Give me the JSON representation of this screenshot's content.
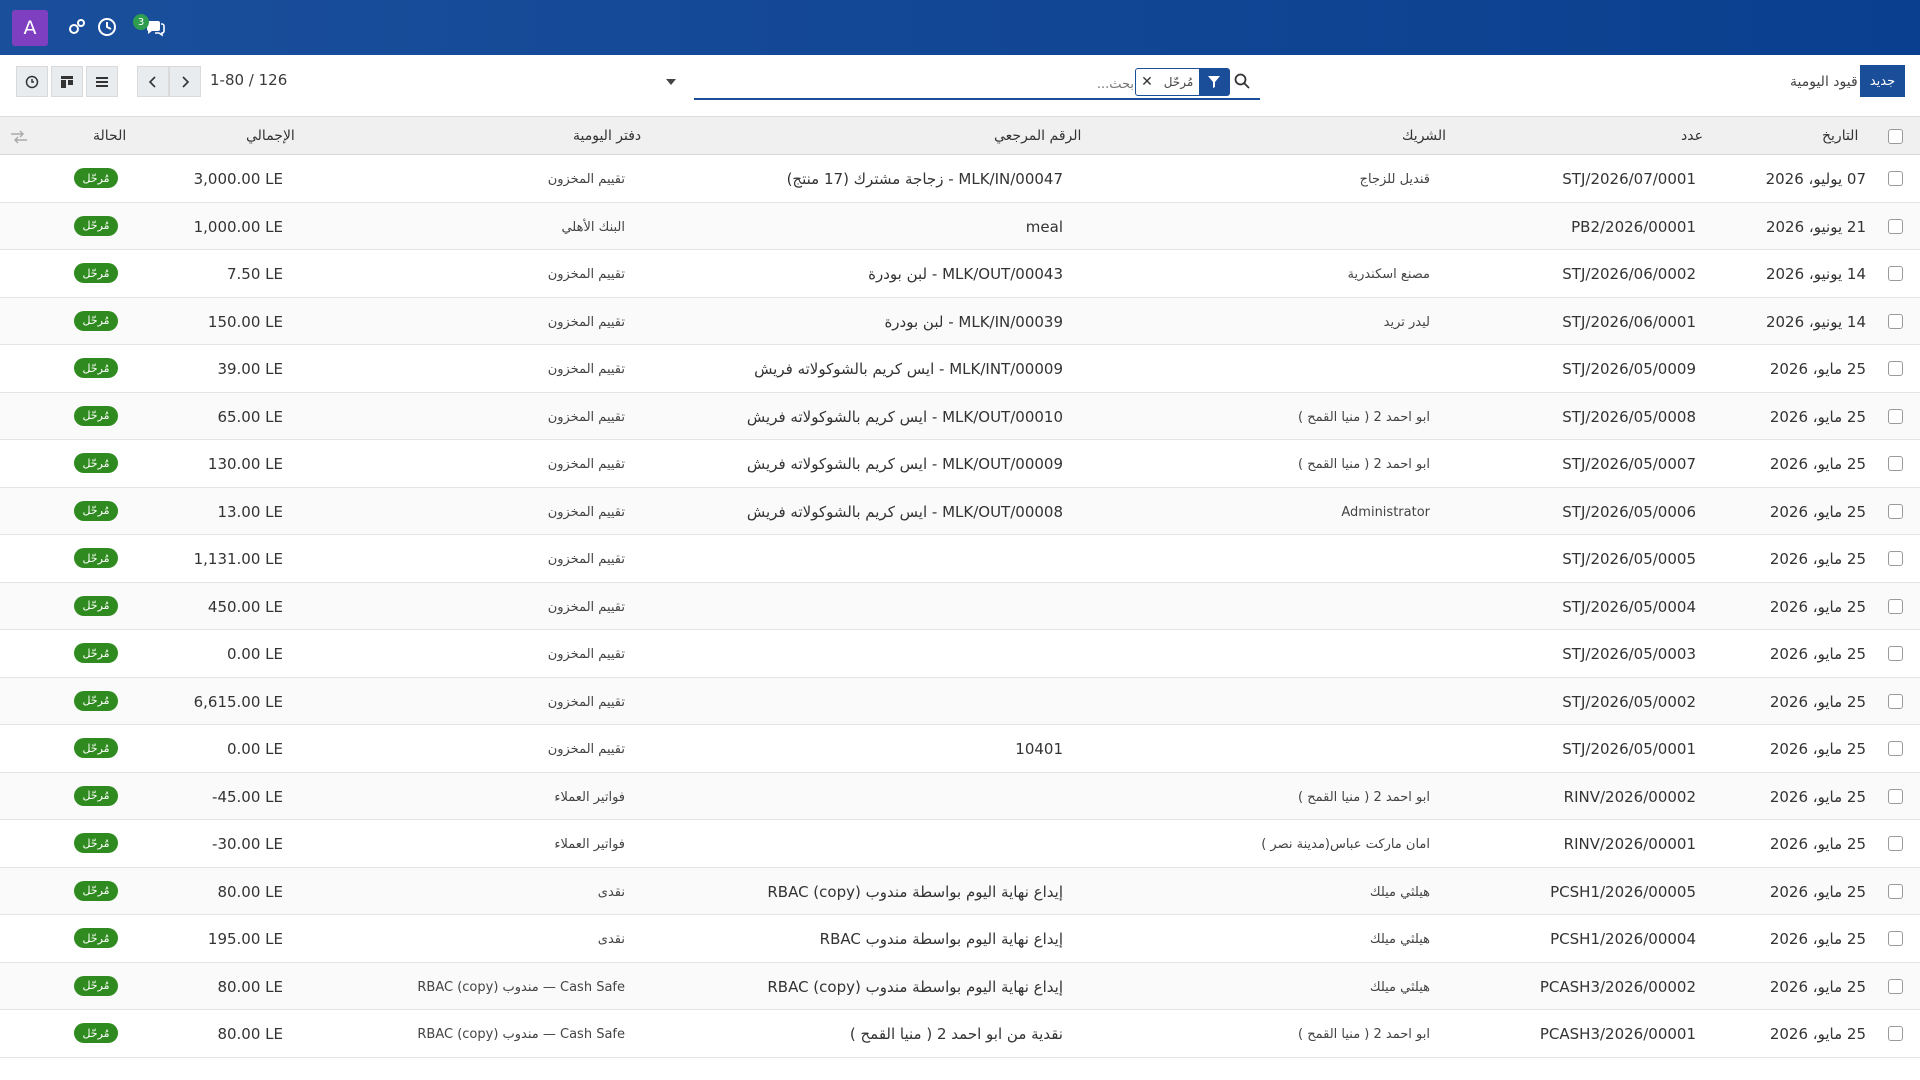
{
  "navbar": {
    "avatar_letter": "A",
    "chat_count": "3",
    "icons": [
      "settings-icon",
      "clock-icon",
      "chat-icon"
    ]
  },
  "control": {
    "pager": "1-80 / 126",
    "search_placeholder": "بحث...",
    "facet_value": "مُرحّل",
    "breadcrumb": "قيود اليومية",
    "new_label": "جديد"
  },
  "columns": {
    "date": "التاريخ",
    "number": "عدد",
    "partner": "الشريك",
    "ref": "الرقم المرجعي",
    "journal": "دفتر اليومية",
    "total": "الإجمالي",
    "status": "الحالة"
  },
  "rows": [
    {
      "date": "07 يوليو، 2026",
      "number": "STJ/2026/07/0001",
      "partner": "قنديل للزجاج",
      "ref": "MLK/IN/00047 - زجاجة مشترك (17 منتج)",
      "journal": "تقييم المخزون",
      "total": "3,000.00 LE",
      "status": "مُرحّل"
    },
    {
      "date": "21 يونيو، 2026",
      "number": "PB2/2026/00001",
      "partner": "",
      "ref": "meal",
      "journal": "البنك الأهلي",
      "total": "1,000.00 LE",
      "status": "مُرحّل"
    },
    {
      "date": "14 يونيو، 2026",
      "number": "STJ/2026/06/0002",
      "partner": "مصنع اسكندرية",
      "ref": "MLK/OUT/00043 - لبن بودرة",
      "journal": "تقييم المخزون",
      "total": "7.50 LE",
      "status": "مُرحّل"
    },
    {
      "date": "14 يونيو، 2026",
      "number": "STJ/2026/06/0001",
      "partner": "ليدر تريد",
      "ref": "MLK/IN/00039 - لبن بودرة",
      "journal": "تقييم المخزون",
      "total": "150.00 LE",
      "status": "مُرحّل"
    },
    {
      "date": "25 مايو، 2026",
      "number": "STJ/2026/05/0009",
      "partner": "",
      "ref": "MLK/INT/00009 - ايس كريم بالشوكولاته فريش",
      "journal": "تقييم المخزون",
      "total": "39.00 LE",
      "status": "مُرحّل"
    },
    {
      "date": "25 مايو، 2026",
      "number": "STJ/2026/05/0008",
      "partner": "ابو احمد 2 ( منيا القمح )",
      "ref": "MLK/OUT/00010 - ايس كريم بالشوكولاته فريش",
      "journal": "تقييم المخزون",
      "total": "65.00 LE",
      "status": "مُرحّل"
    },
    {
      "date": "25 مايو، 2026",
      "number": "STJ/2026/05/0007",
      "partner": "ابو احمد 2 ( منيا القمح )",
      "ref": "MLK/OUT/00009 - ايس كريم بالشوكولاته فريش",
      "journal": "تقييم المخزون",
      "total": "130.00 LE",
      "status": "مُرحّل"
    },
    {
      "date": "25 مايو، 2026",
      "number": "STJ/2026/05/0006",
      "partner": "Administrator",
      "ref": "MLK/OUT/00008 - ايس كريم بالشوكولاته فريش",
      "journal": "تقييم المخزون",
      "total": "13.00 LE",
      "status": "مُرحّل"
    },
    {
      "date": "25 مايو، 2026",
      "number": "STJ/2026/05/0005",
      "partner": "",
      "ref": "",
      "journal": "تقييم المخزون",
      "total": "1,131.00 LE",
      "status": "مُرحّل"
    },
    {
      "date": "25 مايو، 2026",
      "number": "STJ/2026/05/0004",
      "partner": "",
      "ref": "",
      "journal": "تقييم المخزون",
      "total": "450.00 LE",
      "status": "مُرحّل"
    },
    {
      "date": "25 مايو، 2026",
      "number": "STJ/2026/05/0003",
      "partner": "",
      "ref": "",
      "journal": "تقييم المخزون",
      "total": "0.00 LE",
      "status": "مُرحّل"
    },
    {
      "date": "25 مايو، 2026",
      "number": "STJ/2026/05/0002",
      "partner": "",
      "ref": "",
      "journal": "تقييم المخزون",
      "total": "6,615.00 LE",
      "status": "مُرحّل"
    },
    {
      "date": "25 مايو، 2026",
      "number": "STJ/2026/05/0001",
      "partner": "",
      "ref": "10401",
      "journal": "تقييم المخزون",
      "total": "0.00 LE",
      "status": "مُرحّل"
    },
    {
      "date": "25 مايو، 2026",
      "number": "RINV/2026/00002",
      "partner": "ابو احمد 2 ( منيا القمح )",
      "ref": "",
      "journal": "فواتير العملاء",
      "total": "-45.00 LE",
      "status": "مُرحّل"
    },
    {
      "date": "25 مايو، 2026",
      "number": "RINV/2026/00001",
      "partner": "امان ماركت عباس(مدينة نصر )",
      "ref": "",
      "journal": "فواتير العملاء",
      "total": "-30.00 LE",
      "status": "مُرحّل"
    },
    {
      "date": "25 مايو، 2026",
      "number": "PCSH1/2026/00005",
      "partner": "هيلثي ميلك",
      "ref": "إيداع نهاية اليوم بواسطة مندوب RBAC (copy)",
      "journal": "نقدى",
      "total": "80.00 LE",
      "status": "مُرحّل"
    },
    {
      "date": "25 مايو، 2026",
      "number": "PCSH1/2026/00004",
      "partner": "هيلثي ميلك",
      "ref": "إيداع نهاية اليوم بواسطة مندوب RBAC",
      "journal": "نقدى",
      "total": "195.00 LE",
      "status": "مُرحّل"
    },
    {
      "date": "25 مايو، 2026",
      "number": "PCASH3/2026/00002",
      "partner": "هيلثي ميلك",
      "ref": "إيداع نهاية اليوم بواسطة مندوب RBAC (copy)",
      "journal": "Cash Safe — مندوب RBAC (copy)",
      "total": "80.00 LE",
      "status": "مُرحّل"
    },
    {
      "date": "25 مايو، 2026",
      "number": "PCASH3/2026/00001",
      "partner": "ابو احمد 2 ( منيا القمح )",
      "ref": "نقدية من ابو احمد 2 ( منيا القمح )",
      "journal": "Cash Safe — مندوب RBAC (copy)",
      "total": "80.00 LE",
      "status": "مُرحّل"
    }
  ]
}
